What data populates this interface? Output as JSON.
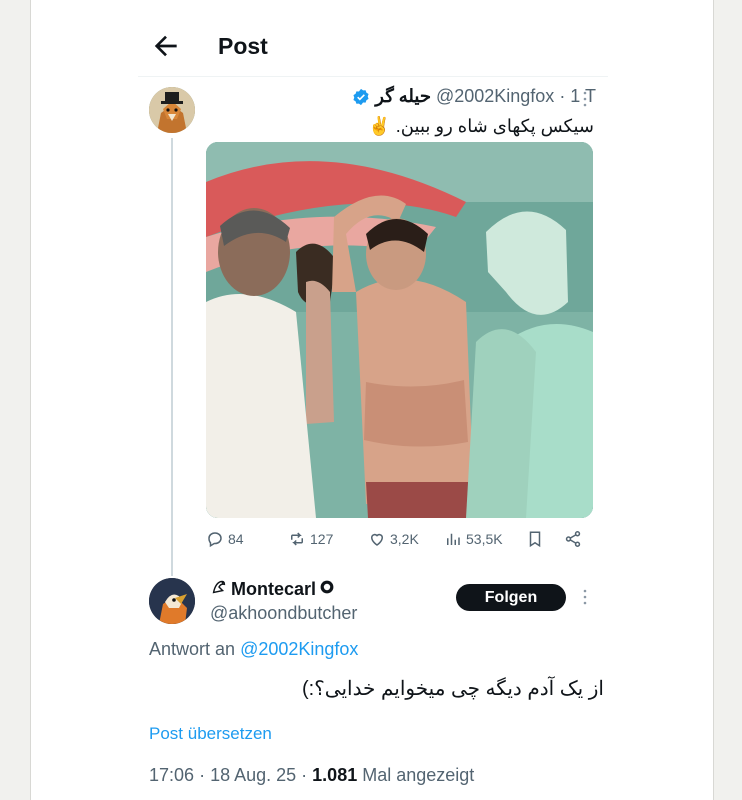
{
  "header": {
    "title": "Post"
  },
  "tweet": {
    "author_name": "حیله گر",
    "handle": "@2002Kingfox",
    "time": "· 1 T",
    "text": "سیکس پکهای شاه رو ببین. ✌️",
    "stats": {
      "replies": "84",
      "reposts": "127",
      "likes": "3,2K",
      "views": "53,5K"
    }
  },
  "reply": {
    "author_name": "Montecarl",
    "handle": "@akhoondbutcher",
    "follow_label": "Folgen",
    "reply_to_prefix": "Antwort an",
    "reply_to_handle": "@2002Kingfox",
    "text": "از یک آدم دیگه چی میخوایم خدایی؟:)",
    "translate_label": "Post übersetzen",
    "time": "17:06",
    "date": "18 Aug. 25",
    "views_count": "1.081",
    "views_label": "Mal angezeigt"
  },
  "colors": {
    "accent": "#1d9bf0",
    "text": "#0f1419",
    "secondary": "#536471"
  }
}
